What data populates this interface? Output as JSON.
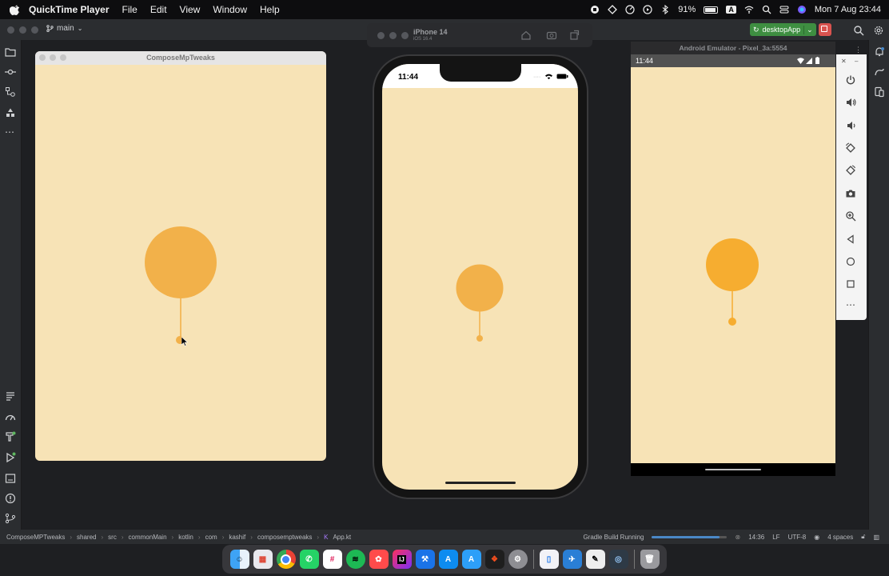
{
  "menubar": {
    "app_name": "QuickTime Player",
    "items": [
      "File",
      "Edit",
      "View",
      "Window",
      "Help"
    ],
    "battery": "91%",
    "input_source": "A",
    "datetime": "Mon 7 Aug  23:44"
  },
  "ide": {
    "branch": "main",
    "run_config": "desktopApp",
    "breadcrumbs": [
      "ComposeMPTweaks",
      "shared",
      "src",
      "commonMain",
      "kotlin",
      "com",
      "kashif",
      "composemptweaks",
      "App.kt"
    ],
    "build_status": "Gradle Build Running",
    "build_progress": 0.9,
    "caret": "14:36",
    "line_sep": "LF",
    "encoding": "UTF-8",
    "indent": "4 spaces"
  },
  "desktop_window": {
    "title": "ComposeMpTweaks",
    "background": "#f7e3b6",
    "ball_color": "#f2b14a"
  },
  "simulator": {
    "device": "iPhone 14",
    "os": "iOS 16.4",
    "time": "11:44",
    "ball_color": "#f2b14a"
  },
  "emulator": {
    "title": "Android Emulator - Pixel_3a:5554",
    "time": "11:44",
    "ball_color": "#f6ad30"
  },
  "dock": {
    "apps": [
      "Finder",
      "Launchpad",
      "Chrome",
      "WhatsApp",
      "Slack",
      "Spotify",
      "Mural",
      "IntelliJ IDEA",
      "Xcode",
      "App Store",
      "Instruments",
      "Figma",
      "System Settings",
      "Simulator",
      "Xcode Simulator",
      "Inkscape",
      "QuickTime",
      "Trash"
    ]
  }
}
